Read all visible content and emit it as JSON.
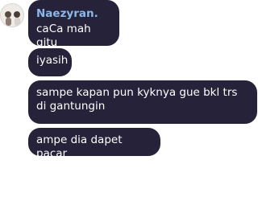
{
  "chat": {
    "sender_name": "Naezyran.",
    "messages": [
      {
        "text": "caCa mah gitu"
      },
      {
        "text": "iyasih"
      },
      {
        "text": "sampe kapan pun kyknya gue bkl trs di gantungin"
      },
      {
        "text": "ampe dia dapet pacar"
      }
    ]
  },
  "colors": {
    "bubble_background": "#26223a",
    "bubble_text": "#ffffff",
    "sender_name": "#8ab8e8"
  },
  "icons": {
    "avatar": "avatar-photo"
  }
}
